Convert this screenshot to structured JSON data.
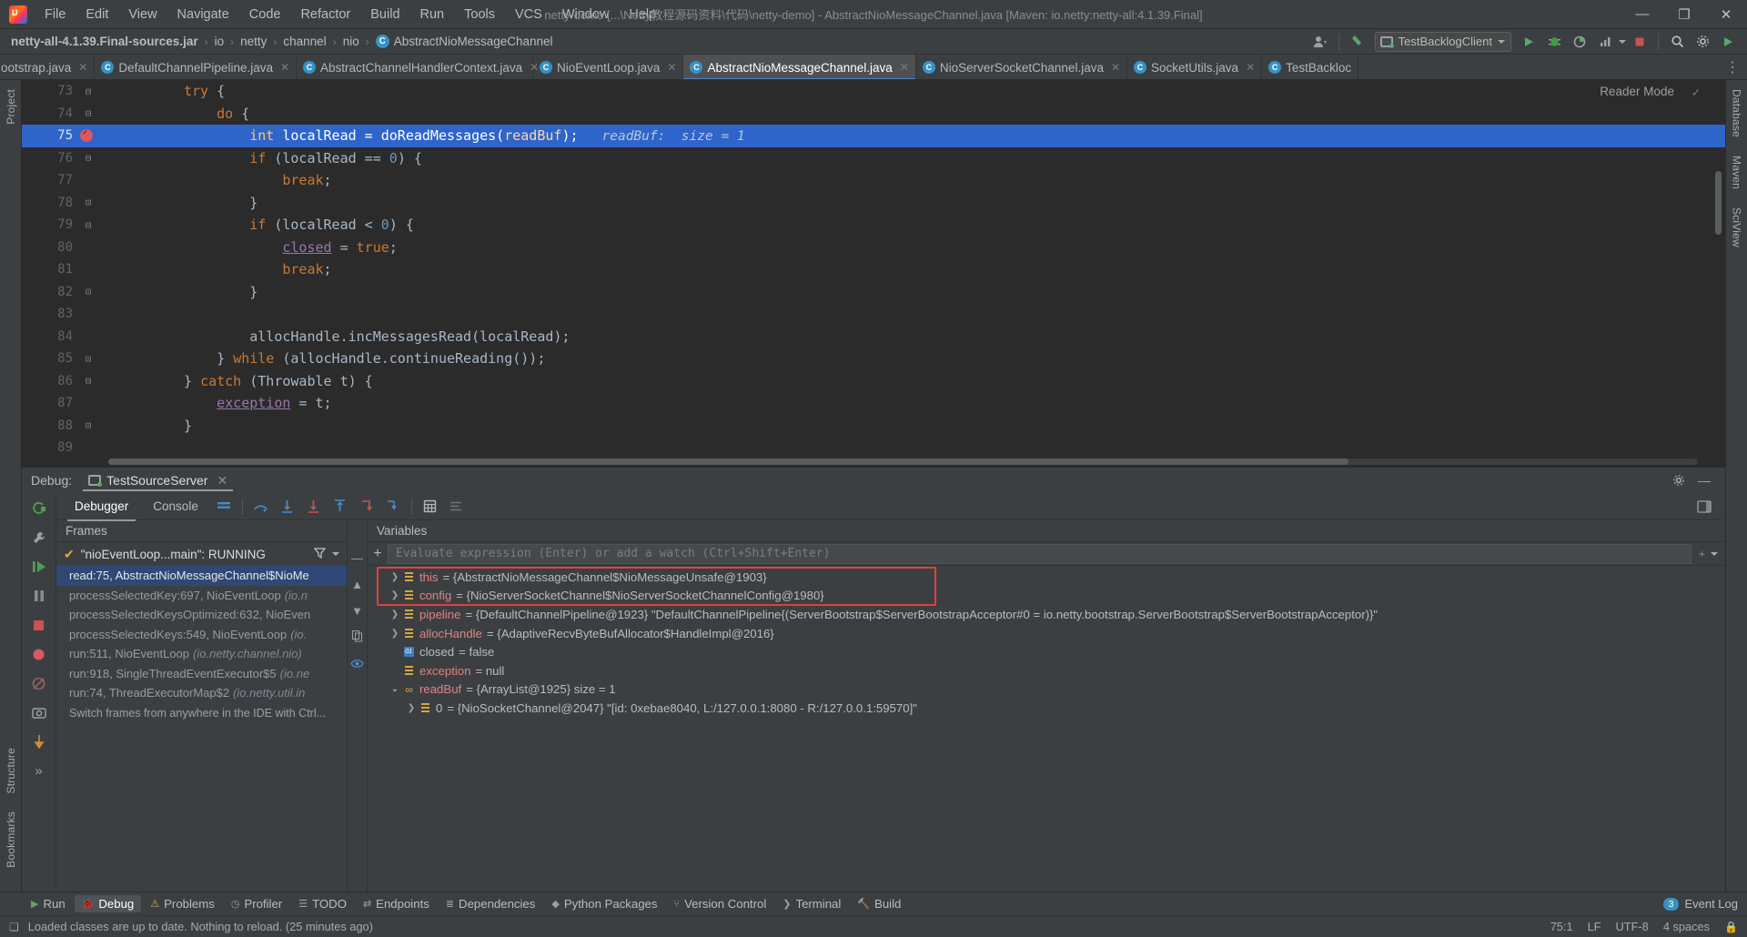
{
  "titlebar": {
    "window_title": "netty-demo [...\\Netty教程源码资料\\代码\\netty-demo] - AbstractNioMessageChannel.java [Maven: io.netty:netty-all:4.1.39.Final]",
    "menus": [
      "File",
      "Edit",
      "View",
      "Navigate",
      "Code",
      "Refactor",
      "Build",
      "Run",
      "Tools",
      "VCS",
      "Window",
      "Help"
    ],
    "minimize": "—",
    "maximize": "❐",
    "close": "✕"
  },
  "navbar": {
    "crumbs": [
      "netty-all-4.1.39.Final-sources.jar",
      "io",
      "netty",
      "channel",
      "nio",
      "AbstractNioMessageChannel"
    ],
    "class_badge": "C",
    "separator": "›",
    "run_config": "TestBacklogClient",
    "icons": {
      "user": "person-icon",
      "vcs_update": "vcs-update-icon",
      "run": "run-icon",
      "debug": "debug-icon",
      "run_coverage": "coverage-icon",
      "profile": "profile-icon",
      "stop": "stop-icon",
      "search": "search-icon",
      "settings": "gear-icon",
      "play": "play-icon"
    }
  },
  "editor_tabs": [
    {
      "label": "ootstrap.java",
      "icon": "java-class-icon",
      "active": false
    },
    {
      "label": "DefaultChannelPipeline.java",
      "icon": "java-class-icon",
      "active": false
    },
    {
      "label": "AbstractChannelHandlerContext.java",
      "icon": "java-class-icon",
      "active": false
    },
    {
      "label": "NioEventLoop.java",
      "icon": "java-class-icon",
      "active": false
    },
    {
      "label": "AbstractNioMessageChannel.java",
      "icon": "java-class-icon",
      "active": true
    },
    {
      "label": "NioServerSocketChannel.java",
      "icon": "java-class-icon",
      "active": false
    },
    {
      "label": "SocketUtils.java",
      "icon": "java-class-icon",
      "active": false
    },
    {
      "label": "TestBackloc",
      "icon": "java-class-icon",
      "active": false
    }
  ],
  "editor": {
    "reader_mode": "Reader Mode",
    "lines": [
      {
        "num": "73",
        "indent": 0,
        "html": "<span class=\"kw\">try</span> {",
        "fold": "minus"
      },
      {
        "num": "74",
        "indent": 0,
        "html": "    <span class=\"kw\">do</span> {",
        "fold": "minus"
      },
      {
        "num": "75",
        "indent": 0,
        "html": "        <span class=\"kw\">int</span> localRead = doReadMessages(<span class=\"fld\">readBuf</span>);",
        "highlight": true,
        "breakpoint": true,
        "hint": "readBuf:  size = 1"
      },
      {
        "num": "76",
        "indent": 0,
        "html": "        <span class=\"kw\">if</span> (localRead == <span class=\"num\">0</span>) {",
        "fold": "minus"
      },
      {
        "num": "77",
        "indent": 0,
        "html": "            <span class=\"kw\">break</span>;"
      },
      {
        "num": "78",
        "indent": 0,
        "html": "        }",
        "fold": "end"
      },
      {
        "num": "79",
        "indent": 0,
        "html": "        <span class=\"kw\">if</span> (localRead &lt; <span class=\"num\">0</span>) {",
        "fold": "minus"
      },
      {
        "num": "80",
        "indent": 0,
        "html": "            <span class=\"fld-u\">closed</span> = <span class=\"kw\">true</span>;"
      },
      {
        "num": "81",
        "indent": 0,
        "html": "            <span class=\"kw\">break</span>;"
      },
      {
        "num": "82",
        "indent": 0,
        "html": "        }",
        "fold": "end"
      },
      {
        "num": "83",
        "indent": 0,
        "html": ""
      },
      {
        "num": "84",
        "indent": 0,
        "html": "        allocHandle.incMessagesRead(localRead);"
      },
      {
        "num": "85",
        "indent": 0,
        "html": "    } <span class=\"kw\">while</span> (allocHandle.continueReading());",
        "fold": "end"
      },
      {
        "num": "86",
        "indent": 0,
        "html": "} <span class=\"kw\">catch</span> (Throwable t) {",
        "fold": "minus"
      },
      {
        "num": "87",
        "indent": 0,
        "html": "    <span class=\"fld-u\">exception</span> = t;"
      },
      {
        "num": "88",
        "indent": 0,
        "html": "}",
        "fold": "end"
      },
      {
        "num": "89",
        "indent": 0,
        "html": ""
      }
    ]
  },
  "debug": {
    "panel_label": "Debug:",
    "session_name": "TestSourceServer",
    "tabs": [
      "Debugger",
      "Console"
    ],
    "active_tab": "Debugger",
    "frames_title": "Frames",
    "variables_title": "Variables",
    "thread": "\"nioEventLoop...main\": RUNNING",
    "frames": [
      {
        "text": "read:75, AbstractNioMessageChannel$NioMe",
        "italic": "",
        "selected": true
      },
      {
        "text": "processSelectedKey:697, NioEventLoop",
        "italic": "(io.n",
        "selected": false
      },
      {
        "text": "processSelectedKeysOptimized:632, NioEven",
        "italic": "",
        "selected": false
      },
      {
        "text": "processSelectedKeys:549, NioEventLoop",
        "italic": "(io.",
        "selected": false
      },
      {
        "text": "run:511, NioEventLoop",
        "italic": "(io.netty.channel.nio)",
        "selected": false
      },
      {
        "text": "run:918, SingleThreadEventExecutor$5",
        "italic": "(io.ne",
        "selected": false
      },
      {
        "text": "run:74, ThreadExecutorMap$2",
        "italic": "(io.netty.util.in",
        "selected": false
      }
    ],
    "frames_hint": "Switch frames from anywhere in the IDE with Ctrl...",
    "watch_placeholder": "Evaluate expression (Enter) or add a watch (Ctrl+Shift+Enter)",
    "variables": [
      {
        "arrow": "closed",
        "icon": "field",
        "name": "this",
        "name_kind": "field",
        "value": "= {AbstractNioMessageChannel$NioMessageUnsafe@1903}",
        "indent": 0
      },
      {
        "arrow": "closed",
        "icon": "field",
        "name": "config",
        "name_kind": "field",
        "value": "= {NioServerSocketChannel$NioServerSocketChannelConfig@1980}",
        "indent": 0
      },
      {
        "arrow": "closed",
        "icon": "field",
        "name": "pipeline",
        "name_kind": "field",
        "value": "= {DefaultChannelPipeline@1923} \"DefaultChannelPipeline{(ServerBootstrap$ServerBootstrapAcceptor#0 = io.netty.bootstrap.ServerBootstrap$ServerBootstrapAcceptor)}\"",
        "indent": 0
      },
      {
        "arrow": "closed",
        "icon": "field",
        "name": "allocHandle",
        "name_kind": "field",
        "value": "= {AdaptiveRecvByteBufAllocator$HandleImpl@2016}",
        "indent": 0
      },
      {
        "arrow": "none",
        "icon": "local",
        "name": "closed",
        "name_kind": "local",
        "value": "= false",
        "indent": 0
      },
      {
        "arrow": "none",
        "icon": "field",
        "name": "exception",
        "name_kind": "field",
        "value": "= null",
        "indent": 0
      },
      {
        "arrow": "open",
        "icon": "obj",
        "name": "readBuf",
        "name_kind": "field",
        "value": "= {ArrayList@1925}  size = 1",
        "indent": 0,
        "boxed": true
      },
      {
        "arrow": "closed",
        "icon": "field",
        "name": "0",
        "name_kind": "local",
        "value": "= {NioSocketChannel@2047} \"[id: 0xebae8040, L:/127.0.0.1:8080 - R:/127.0.0.1:59570]\"",
        "indent": 1,
        "boxed": true
      }
    ]
  },
  "tool_windows": [
    {
      "label": "Run",
      "icon": "run-icon",
      "active": false
    },
    {
      "label": "Debug",
      "icon": "debug-icon",
      "active": true
    },
    {
      "label": "Problems",
      "icon": "problems-icon",
      "active": false
    },
    {
      "label": "Profiler",
      "icon": "profiler-icon",
      "active": false
    },
    {
      "label": "TODO",
      "icon": "todo-icon",
      "active": false
    },
    {
      "label": "Endpoints",
      "icon": "endpoints-icon",
      "active": false
    },
    {
      "label": "Dependencies",
      "icon": "dependencies-icon",
      "active": false
    },
    {
      "label": "Python Packages",
      "icon": "python-icon",
      "active": false
    },
    {
      "label": "Version Control",
      "icon": "branch-icon",
      "active": false
    },
    {
      "label": "Terminal",
      "icon": "terminal-icon",
      "active": false
    },
    {
      "label": "Build",
      "icon": "build-icon",
      "active": false
    }
  ],
  "event_log": {
    "count": "3",
    "label": "Event Log"
  },
  "statusbar": {
    "message": "Loaded classes are up to date. Nothing to reload. (25 minutes ago)",
    "caret": "75:1",
    "line_sep": "LF",
    "encoding": "UTF-8",
    "indent": "4 spaces",
    "lock": "lock-icon"
  },
  "left_tool_tabs": [
    "Project",
    "Structure",
    "Bookmarks"
  ],
  "right_tool_tabs": [
    "Database",
    "Maven",
    "SciView"
  ]
}
